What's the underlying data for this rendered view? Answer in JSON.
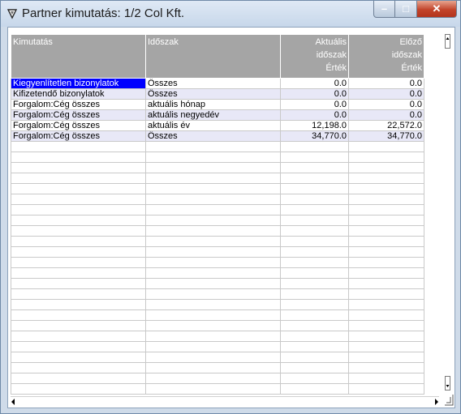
{
  "window": {
    "title": "Partner kimutatás: 1/2 Col Kft.",
    "controls": {
      "minimize": "–",
      "maximize": "□",
      "close": "✕"
    }
  },
  "grid": {
    "headers": [
      {
        "lines": [
          "Kimutatás"
        ]
      },
      {
        "lines": [
          "Időszak"
        ]
      },
      {
        "lines": [
          "Aktuális",
          "időszak",
          "Érték"
        ]
      },
      {
        "lines": [
          "Előző",
          "időszak",
          "Érték"
        ]
      }
    ],
    "rows": [
      {
        "kimutatas": "Kiegyenlítetlen bizonylatok",
        "idoszak": "Összes",
        "aktualis": "0.0",
        "elozo": "0.0"
      },
      {
        "kimutatas": "Kifizetendő bizonylatok",
        "idoszak": "Összes",
        "aktualis": "0.0",
        "elozo": "0.0"
      },
      {
        "kimutatas": "Forgalom:Cég összes",
        "idoszak": "aktuális hónap",
        "aktualis": "0.0",
        "elozo": "0.0"
      },
      {
        "kimutatas": "Forgalom:Cég összes",
        "idoszak": "aktuális negyedév",
        "aktualis": "0.0",
        "elozo": "0.0"
      },
      {
        "kimutatas": "Forgalom:Cég összes",
        "idoszak": "aktuális év",
        "aktualis": "12,198.0",
        "elozo": "22,572.0"
      },
      {
        "kimutatas": "Forgalom:Cég összes",
        "idoszak": "Összes",
        "aktualis": "34,770.0",
        "elozo": "34,770.0"
      }
    ],
    "empty_row_count": 24,
    "selected_row": 0
  }
}
